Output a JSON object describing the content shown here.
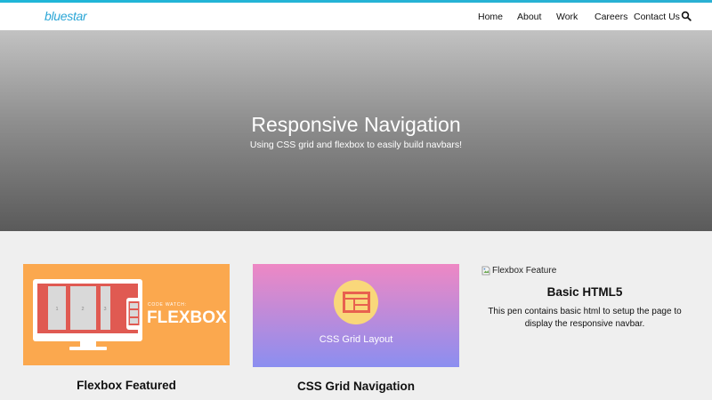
{
  "header": {
    "logo": "bluestar",
    "nav": [
      "Home",
      "About",
      "Work",
      "Careers",
      "Contact Us"
    ]
  },
  "hero": {
    "title": "Responsive Navigation",
    "subtitle": "Using CSS grid and flexbox to easily build navbars!"
  },
  "cards": [
    {
      "image_label": "CODE WATCH:",
      "image_title": "FLEXBOX",
      "panel_numbers": [
        "1",
        "2",
        "3"
      ],
      "title": "Flexbox Featured"
    },
    {
      "image_caption": "CSS Grid Layout",
      "title": "CSS Grid Navigation"
    },
    {
      "image_alt": "Flexbox Feature",
      "title": "Basic HTML5",
      "text": "This pen contains basic html to setup the page to display the responsive navbar."
    }
  ],
  "colors": {
    "accent": "#1fb6d8",
    "logo": "#2aa6d6",
    "flexbox_card": "#fba84e",
    "grid_card_top": "#ee88c4",
    "grid_card_bottom": "#8b8ef0"
  }
}
